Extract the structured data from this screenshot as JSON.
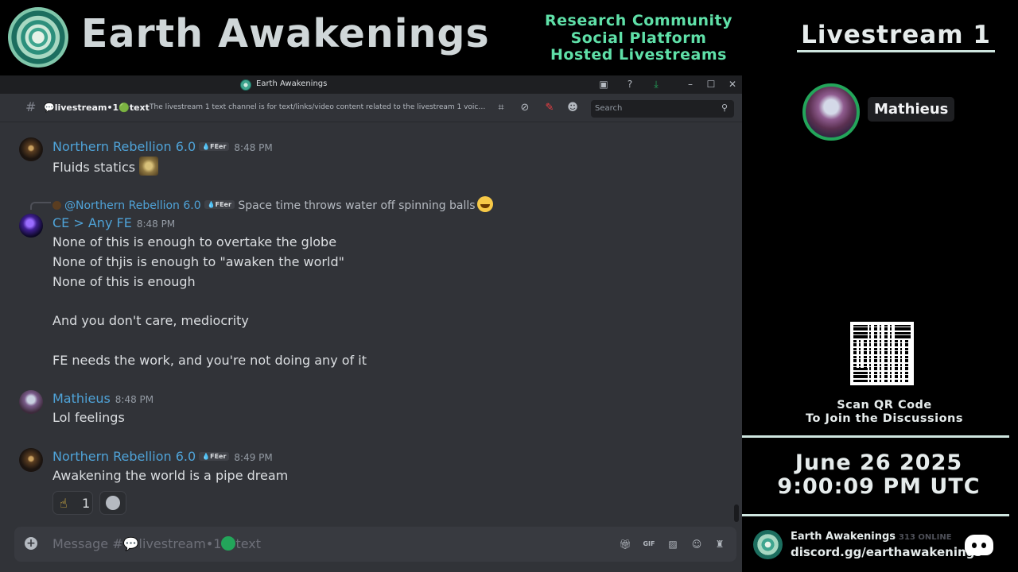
{
  "banner": {
    "title": "Earth Awakenings",
    "tagline": [
      "Research Community",
      "Social Platform",
      "Hosted Livestreams"
    ]
  },
  "window": {
    "title": "Earth Awakenings"
  },
  "channel": {
    "name": "💬livestream•1🟢text",
    "topic": "The livestream 1 text channel is for text/links/video content related to the livestream 1 voice ...",
    "search_placeholder": "Search"
  },
  "messages": [
    {
      "author": "Northern Rebellion 6.0",
      "badge": "💧FEer",
      "time": "8:48 PM",
      "text": "Fluids statics"
    },
    {
      "reply_to": "@Northern Rebellion 6.0",
      "reply_badge": "💧FEer",
      "reply_text": "Space time throws water off spinning balls",
      "author": "CE  > Any FE",
      "time": "8:48 PM",
      "text": "None of this is enough to overtake the globe\nNone of thjis is enough to \"awaken the world\"\nNone of this is enough\n\nAnd you don't care, mediocrity\n\nFE needs the work, and you're not doing any of it"
    },
    {
      "author": "Mathieus",
      "time": "8:48 PM",
      "text": "Lol feelings"
    },
    {
      "author": "Northern Rebellion 6.0",
      "badge": "💧FEer",
      "time": "8:49 PM",
      "text": "Awakening the world is a pipe dream"
    }
  ],
  "reaction": {
    "emoji": "☝",
    "count": "1"
  },
  "composer": {
    "prefix": "Message #",
    "channel_a": "💬",
    "channel_b": "livestream•1",
    "channel_c": "text"
  },
  "sidebar": {
    "title": "Livestream 1",
    "speaker": "Mathieus",
    "scan": [
      "Scan QR Code",
      "To Join the Discussions"
    ],
    "date": "June 26 2025",
    "time": "9:00:09 PM UTC",
    "server_name": "Earth Awakenings",
    "online": "313 ONLINE",
    "invite": "discord.gg/earthawakenings"
  },
  "icons": [
    "screen-share-icon",
    "help-icon",
    "download-icon",
    "minimize-icon",
    "maximize-icon",
    "close-icon",
    "threads-icon",
    "mute-icon",
    "pin-icon",
    "members-icon",
    "search-icon",
    "add-icon",
    "gift-icon",
    "gif-icon",
    "sticker-icon",
    "emoji-icon",
    "game-icon",
    "discord-logo-icon"
  ],
  "colors": {
    "accent_green": "#5fe0a8",
    "username_blue": "#4fa3d8",
    "online_green": "#23a55a",
    "chat_bg": "#313338"
  }
}
